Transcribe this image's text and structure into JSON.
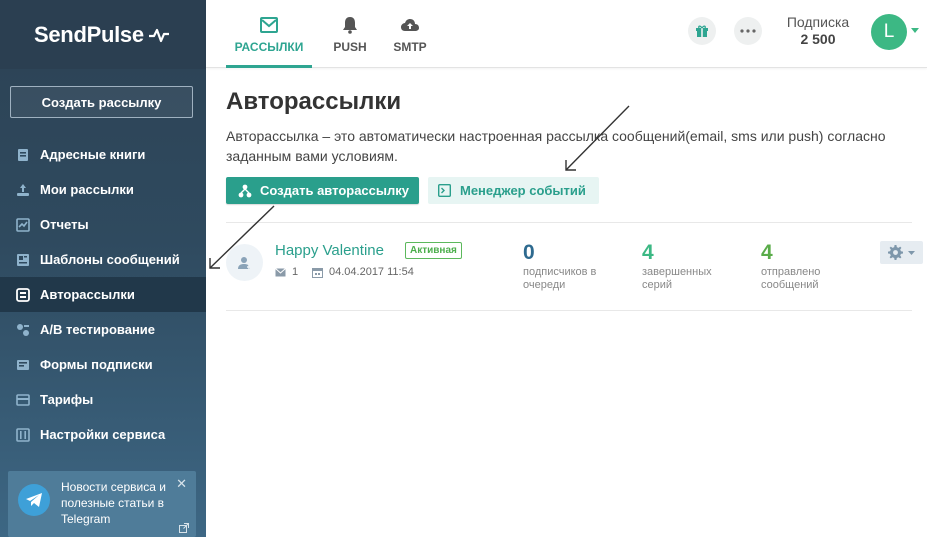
{
  "brand": {
    "name": "SendPulse"
  },
  "sidebar": {
    "create_label": "Создать рассылку",
    "items": [
      {
        "label": "Адресные книги",
        "icon": "address-book-icon"
      },
      {
        "label": "Мои рассылки",
        "icon": "campaigns-icon"
      },
      {
        "label": "Отчеты",
        "icon": "reports-icon"
      },
      {
        "label": "Шаблоны сообщений",
        "icon": "templates-icon"
      },
      {
        "label": "Авторассылки",
        "icon": "automation-icon",
        "active": true
      },
      {
        "label": "A/B тестирование",
        "icon": "ab-test-icon"
      },
      {
        "label": "Формы подписки",
        "icon": "forms-icon"
      },
      {
        "label": "Тарифы",
        "icon": "pricing-icon"
      },
      {
        "label": "Настройки сервиса",
        "icon": "settings-icon"
      }
    ],
    "telegram": {
      "text": "Новости сервиса и полезные статьи в Telegram"
    }
  },
  "topbar": {
    "tabs": [
      {
        "label": "РАССЫЛКИ",
        "icon": "email-icon",
        "active": true
      },
      {
        "label": "PUSH",
        "icon": "bell-icon"
      },
      {
        "label": "SMTP",
        "icon": "cloud-upload-icon"
      }
    ],
    "subscription_label": "Подписка",
    "subscription_value": "2 500",
    "avatar_letter": "L"
  },
  "main": {
    "title": "Авторассылки",
    "description": "Авторассылка – это автоматически настроенная рассылка сообщений(email, sms или push) согласно заданным вами условиям.",
    "create_button": "Создать авторассылку",
    "events_button": "Менеджер событий",
    "automations": [
      {
        "name": "Happy Valentine",
        "status": "Активная",
        "email_count": "1",
        "date": "04.04.2017 11:54",
        "stats": [
          {
            "value": "0",
            "label": "подписчиков в очереди"
          },
          {
            "value": "4",
            "label": "завершенных серий"
          },
          {
            "value": "4",
            "label": "отправлено сообщений"
          }
        ]
      }
    ]
  },
  "colors": {
    "accent": "#2a9f8c",
    "sidebar": "#2f4a5f",
    "active_badge": "#4cae4c",
    "stat_queue": "#2e6a8f",
    "stat_done": "#3cb884",
    "stat_sent": "#5aac4a"
  }
}
